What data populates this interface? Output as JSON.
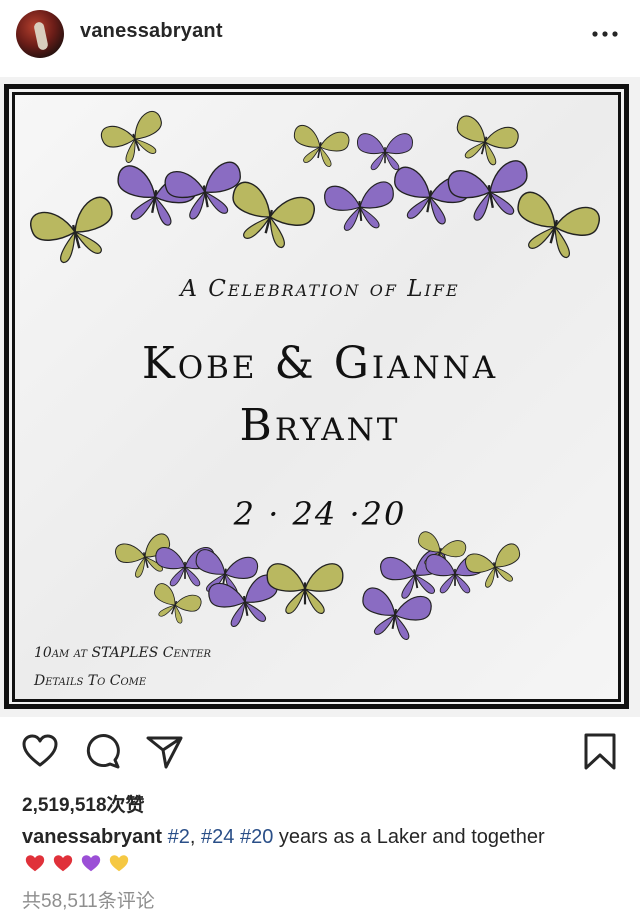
{
  "post": {
    "username": "vanessabryant",
    "more_icon": "more-horizontal-icon"
  },
  "image": {
    "subtitle": "A Celebration of Life",
    "names_line1": "Kobe & Gianna",
    "names_line2": "Bryant",
    "date": "2 · 24 ·20",
    "details_line1": "10am at STAPLES Center",
    "details_line2": "Details To Come",
    "colors": {
      "purple_butterfly": "#8a6cc2",
      "olive_butterfly": "#b9b860",
      "frame": "#111111"
    }
  },
  "actions": {
    "like_icon": "heart-outline-icon",
    "comment_icon": "comment-bubble-icon",
    "share_icon": "paper-plane-icon",
    "save_icon": "bookmark-icon"
  },
  "likes": {
    "count": "2,519,518",
    "suffix": "次赞"
  },
  "caption": {
    "username": "vanessabryant",
    "tag1": "#2",
    "sep1": ", ",
    "tag2": "#24",
    "sep2": " ",
    "tag3": "#20",
    "text": " years as a Laker and together"
  },
  "hearts": [
    {
      "name": "red-heart-icon",
      "color": "#e0313a"
    },
    {
      "name": "red-heart-icon",
      "color": "#e0313a"
    },
    {
      "name": "purple-heart-icon",
      "color": "#9b4fd6"
    },
    {
      "name": "yellow-heart-icon",
      "color": "#f5c843"
    }
  ],
  "comments": {
    "label": "共58,511条评论"
  }
}
